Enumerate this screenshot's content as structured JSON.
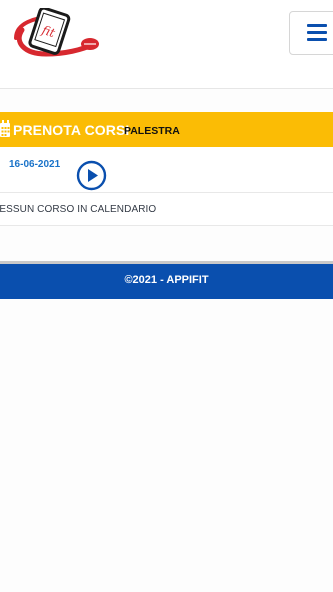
{
  "app": {
    "logo_text": "fit",
    "menu_icon": "hamburger-icon"
  },
  "banner": {
    "title": "PRENOTA CORSI",
    "subtitle": "PALESTRA",
    "icon": "calendar-icon",
    "color": "#fbbc05"
  },
  "schedule": {
    "date": "16-06-2021",
    "play_icon": "play-circle-icon",
    "empty_message": "NESSUN CORSO IN CALENDARIO"
  },
  "footer": {
    "text": "©2021 - APPIFIT",
    "color": "#0a4fae"
  }
}
